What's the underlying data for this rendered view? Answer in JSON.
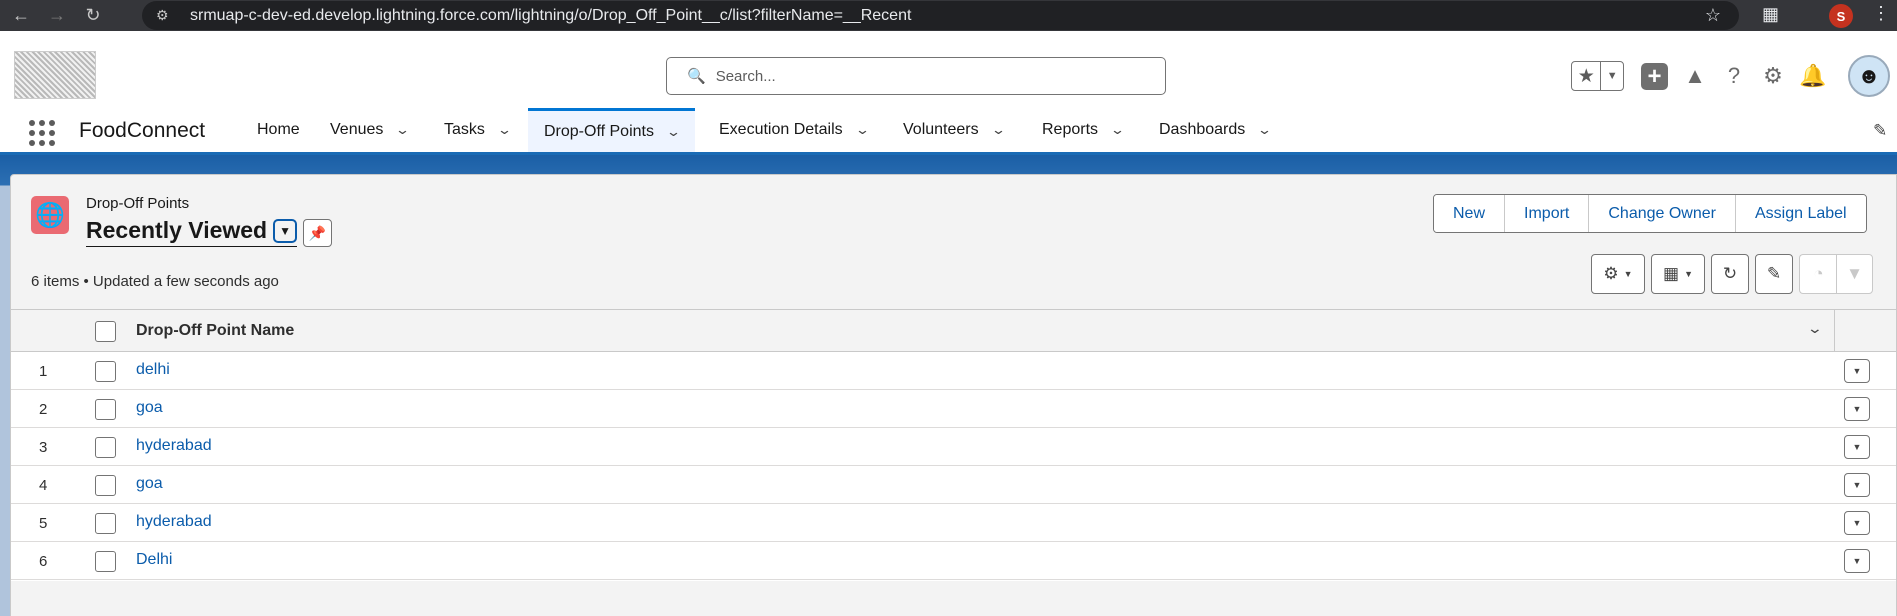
{
  "browser": {
    "url": "srmuap-c-dev-ed.develop.lightning.force.com/lightning/o/Drop_Off_Point__c/list?filterName=__Recent",
    "profile_initial": "S"
  },
  "header": {
    "search_placeholder": "Search..."
  },
  "app": {
    "name": "FoodConnect",
    "nav": [
      {
        "label": "Home",
        "has_menu": false
      },
      {
        "label": "Venues",
        "has_menu": true
      },
      {
        "label": "Tasks",
        "has_menu": true
      },
      {
        "label": "Drop-Off Points",
        "has_menu": true,
        "active": true
      },
      {
        "label": "Execution Details",
        "has_menu": true
      },
      {
        "label": "Volunteers",
        "has_menu": true
      },
      {
        "label": "Reports",
        "has_menu": true
      },
      {
        "label": "Dashboards",
        "has_menu": true
      }
    ]
  },
  "list_view": {
    "object_label": "Drop-Off Points",
    "title": "Recently Viewed",
    "meta": "6 items • Updated a few seconds ago",
    "actions": [
      "New",
      "Import",
      "Change Owner",
      "Assign Label"
    ],
    "column_header": "Drop-Off Point Name",
    "rows": [
      {
        "num": "1",
        "name": "delhi"
      },
      {
        "num": "2",
        "name": "goa"
      },
      {
        "num": "3",
        "name": "hyderabad"
      },
      {
        "num": "4",
        "name": "goa"
      },
      {
        "num": "5",
        "name": "hyderabad"
      },
      {
        "num": "6",
        "name": "Delhi"
      }
    ]
  },
  "colors": {
    "brand_blue": "#0176d3",
    "link_blue": "#0b5cab",
    "object_icon": "#ea6a72"
  }
}
